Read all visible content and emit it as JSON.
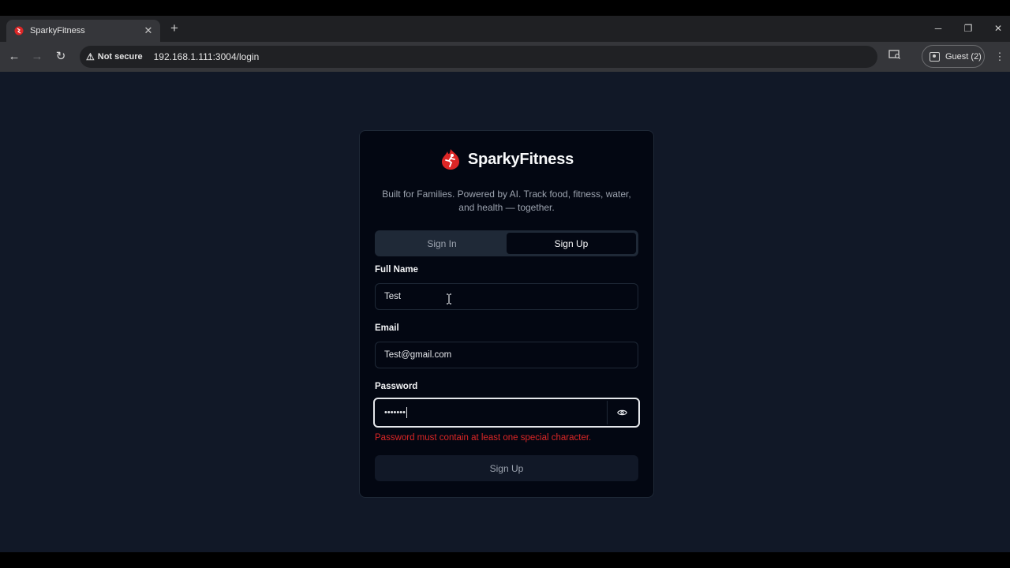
{
  "browser": {
    "tab_title": "SparkyFitness",
    "security_label": "Not secure",
    "url": "192.168.1.111:3004/login",
    "profile_label": "Guest (2)"
  },
  "app": {
    "brand_name": "SparkyFitness",
    "tagline": "Built for Families. Powered by AI. Track food, fitness, water, and health — together.",
    "tabs": [
      {
        "label": "Sign In",
        "active": false
      },
      {
        "label": "Sign Up",
        "active": true
      }
    ],
    "form": {
      "full_name_label": "Full Name",
      "full_name_value": "Test",
      "email_label": "Email",
      "email_value": "Test@gmail.com",
      "password_label": "Password",
      "password_masked": "•••••••",
      "password_error": "Password must contain at least one special character.",
      "submit_label": "Sign Up"
    }
  },
  "colors": {
    "page_bg": "#111827",
    "card_bg": "#030712",
    "error": "#dc2626",
    "brand_red": "#dc2626"
  }
}
